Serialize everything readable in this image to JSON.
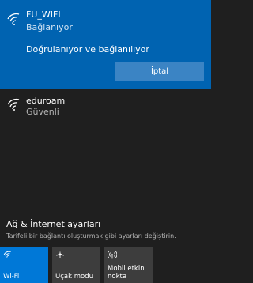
{
  "networks": {
    "active": {
      "ssid": "FU_WIFI",
      "status": "Bağlanıyor",
      "detail": "Doğrulanıyor ve bağlanılıyor",
      "cancel_label": "İptal",
      "icon": "wifi-icon"
    },
    "other": {
      "ssid": "eduroam",
      "status": "Güvenli",
      "icon": "wifi-icon"
    }
  },
  "settings": {
    "title": "Ağ & İnternet ayarları",
    "description": "Tarifeli bir bağlantı oluşturmak gibi ayarları değiştirin."
  },
  "quick_actions": [
    {
      "label": "Wi-Fi",
      "icon": "wifi-icon",
      "active": true
    },
    {
      "label": "Uçak modu",
      "icon": "airplane-icon",
      "active": false
    },
    {
      "label": "Mobil etkin nokta",
      "icon": "hotspot-icon",
      "active": false
    }
  ],
  "colors": {
    "panel_bg": "#1f1f1f",
    "accent": "#0063b1",
    "tile_active": "#0078d7",
    "tile_inactive": "#3d3d3d"
  }
}
